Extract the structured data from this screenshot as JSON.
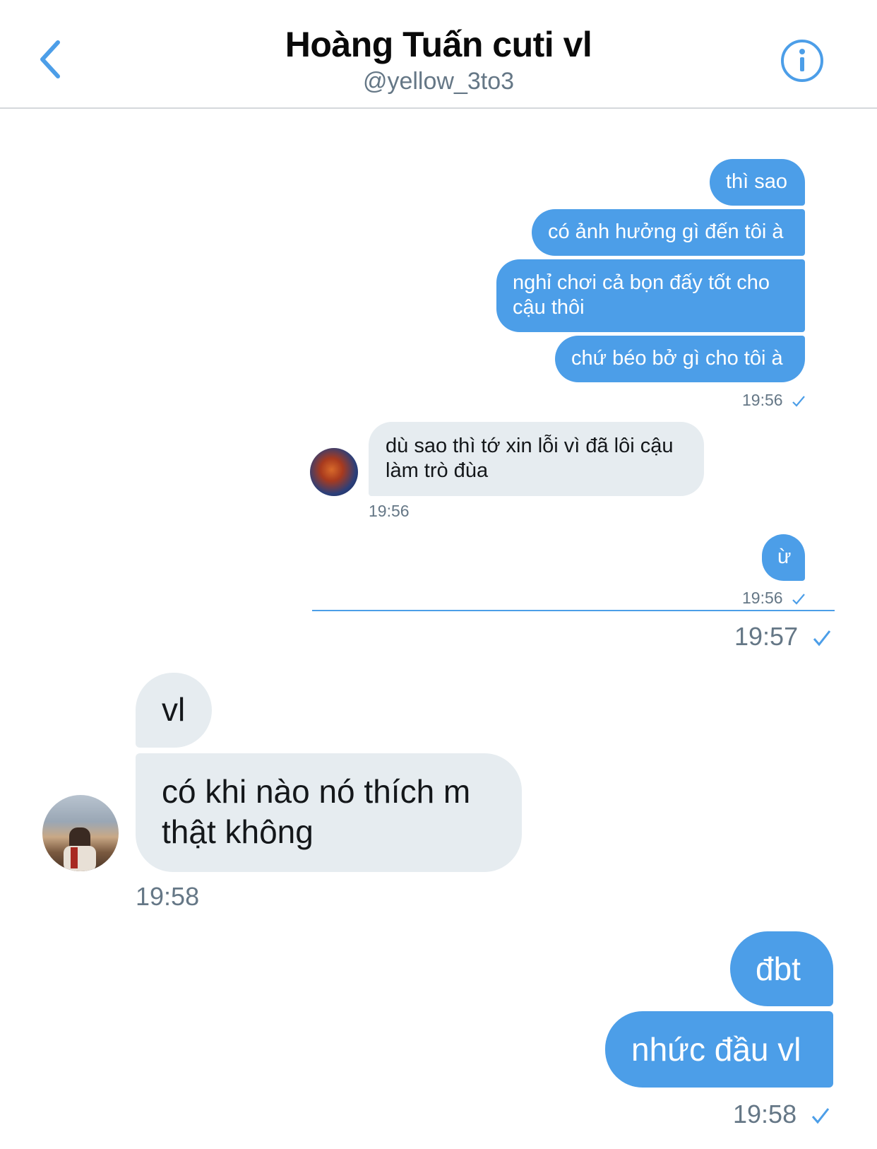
{
  "header": {
    "title": "Hoàng Tuấn cuti vl",
    "handle": "@yellow_3to3",
    "colors": {
      "accent": "#4c9ee8"
    }
  },
  "upper_messages": {
    "out_1": "thì sao",
    "out_2": "có ảnh hưởng gì đến tôi à",
    "out_3_line1": "nghỉ chơi cả bọn đấy tốt cho",
    "out_3_line2": "cậu thôi",
    "out_4": "chứ béo bở gì cho tôi à",
    "time_out_1": "19:56",
    "in_1_line1": "dù sao thì tớ xin lỗi vì đã lôi cậu",
    "in_1_line2": "làm trò đùa",
    "time_in_1": "19:56",
    "out_5": "ừ",
    "time_out_2": "19:56"
  },
  "lower_messages": {
    "time_divider": "19:57",
    "in_1": "vl",
    "in_2_line1": "có khi nào nó thích m",
    "in_2_line2": "thật không",
    "time_in": "19:58",
    "out_1": "đbt",
    "out_2": "nhức đầu vl",
    "time_out": "19:58"
  },
  "icons": {
    "back": "chevron-left-icon",
    "info": "info-icon",
    "read_check": "check-icon"
  }
}
